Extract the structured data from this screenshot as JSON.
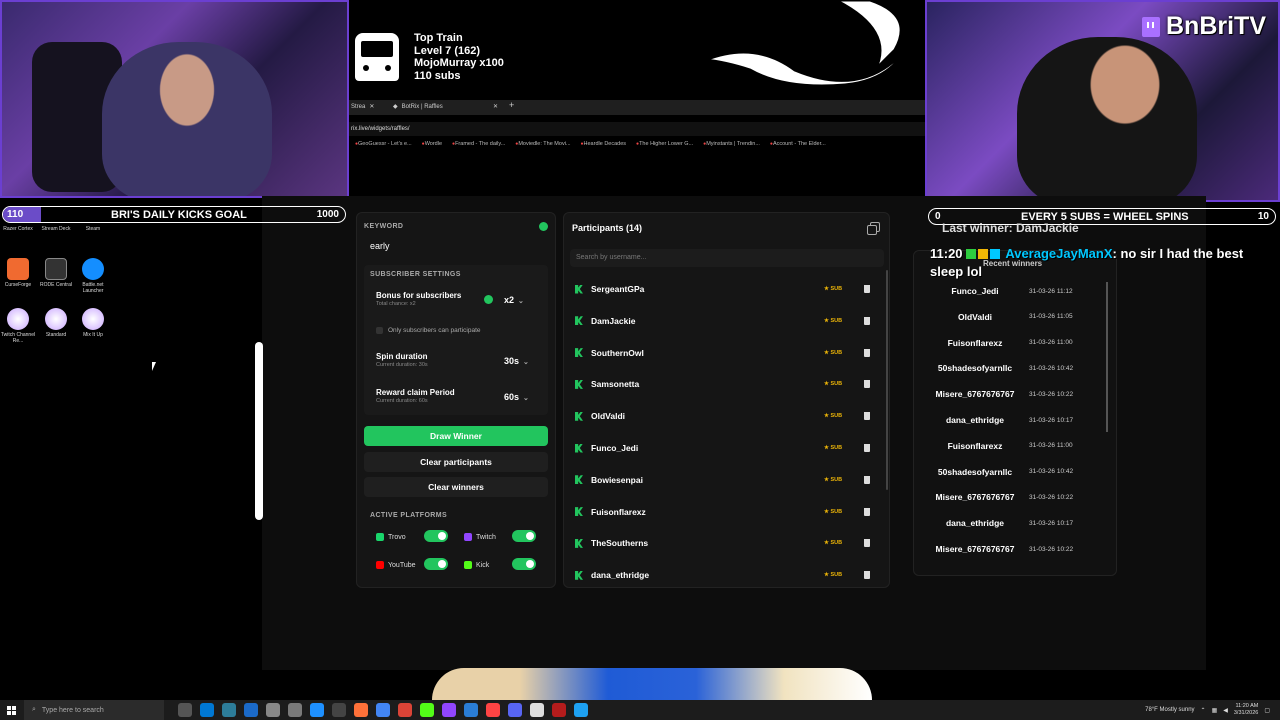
{
  "train": {
    "title": "Top Train",
    "level": "Level 7  (162)",
    "leader": "MojoMurray x100",
    "subs": "110 subs"
  },
  "brand": "BnBriTV",
  "browser": {
    "tabs": [
      "Strea",
      "BotRix | Raffles"
    ],
    "address": "rix.live/widgets/raffles/",
    "bookmarks": [
      "GeoGuessr - Let's e...",
      "Wordle",
      "Framed - The daily...",
      "Moviedle: The Movi...",
      "Heardle Decades",
      "The Higher Lower G...",
      "Myinstants | Trendin...",
      "Account - The Elder..."
    ]
  },
  "goal": {
    "current": "110",
    "label": "BRI'S DAILY KICKS GOAL",
    "target": "1000",
    "progress": 0.11
  },
  "desktop_icons": [
    "Razer Cortex",
    "Stream Deck",
    "Steam",
    "CurseForge",
    "RODE Central",
    "Battle.net Launcher",
    "Twitch Channel Re...",
    "Standard",
    "Mix It Up"
  ],
  "wheel_goal": {
    "current": "0",
    "label": "EVERY 5 SUBS = WHEEL SPINS",
    "target": "10"
  },
  "last_winner": "Last winner: DamJackie",
  "chat": {
    "time": "11:20",
    "user": "AverageJayManX",
    "message": "no sir I had the best sleep lol"
  },
  "raffle": {
    "keyword_label": "KEYWORD",
    "keyword": "early",
    "subscriber_settings": "SUBSCRIBER SETTINGS",
    "bonus_label": "Bonus for subscribers",
    "bonus_sub": "Total chance: x2",
    "bonus_value": "x2",
    "only_subs": "Only subscribers can participate",
    "spin_label": "Spin duration",
    "spin_sub": "Current duration: 30s",
    "spin_value": "30s",
    "reward_label": "Reward claim Period",
    "reward_sub": "Current duration: 60s",
    "reward_value": "60s",
    "draw_button": "Draw Winner",
    "clear_participants": "Clear participants",
    "clear_winners": "Clear winners",
    "active_platforms": "ACTIVE PLATFORMS",
    "platforms": [
      "Trovo",
      "Twitch",
      "YouTube",
      "Kick"
    ]
  },
  "participants": {
    "title": "Participants (14)",
    "search_placeholder": "Search by username...",
    "badge": "SUB",
    "list": [
      "SergeantGPa",
      "DamJackie",
      "SouthernOwl",
      "Samsonetta",
      "OldValdi",
      "Funco_Jedi",
      "Bowiesenpai",
      "Fuisonflarexz",
      "TheSoutherns",
      "dana_ethridge"
    ]
  },
  "recent_winners": {
    "title": "Recent winners",
    "list": [
      {
        "name": "Funco_Jedi",
        "time": "31-03-26 11:12"
      },
      {
        "name": "OldValdi",
        "time": "31-03-26 11:05"
      },
      {
        "name": "Fuisonflarexz",
        "time": "31-03-26 11:00"
      },
      {
        "name": "50shadesofyarnllc",
        "time": "31-03-26 10:42"
      },
      {
        "name": "Misere_6767676767",
        "time": "31-03-26 10:22"
      },
      {
        "name": "dana_ethridge",
        "time": "31-03-26 10:17"
      },
      {
        "name": "Fuisonflarexz",
        "time": "31-03-26 11:00"
      },
      {
        "name": "50shadesofyarnllc",
        "time": "31-03-26 10:42"
      },
      {
        "name": "Misere_6767676767",
        "time": "31-03-26 10:22"
      },
      {
        "name": "dana_ethridge",
        "time": "31-03-26 10:17"
      },
      {
        "name": "Misere_6767676767",
        "time": "31-03-26 10:22"
      }
    ]
  },
  "taskbar": {
    "search": "Type here to search",
    "weather": "78°F  Mostly sunny",
    "time": "11:20 AM",
    "date": "3/31/2026"
  }
}
